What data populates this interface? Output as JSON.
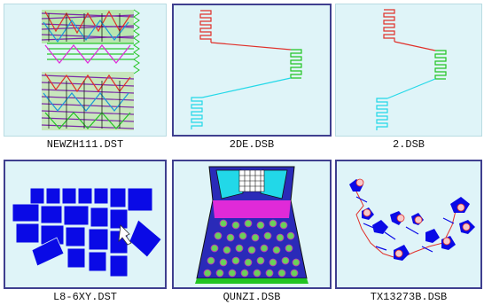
{
  "files": [
    {
      "name": "NEWZH111.DST",
      "selected": false
    },
    {
      "name": "2DE.DSB",
      "selected": true
    },
    {
      "name": "2.DSB",
      "selected": false
    },
    {
      "name": "L8-6XY.DST",
      "selected": true
    },
    {
      "name": "QUNZI.DSB",
      "selected": true
    },
    {
      "name": "TX13273B.DSB",
      "selected": true
    }
  ],
  "colors": {
    "thumb_bg": "#dff4f8",
    "selected_border": "#3f3f8f",
    "stitch_red": "#e0302a",
    "stitch_green": "#22c422",
    "stitch_cyan": "#22d8e8",
    "stitch_blue": "#0a0ae6"
  }
}
